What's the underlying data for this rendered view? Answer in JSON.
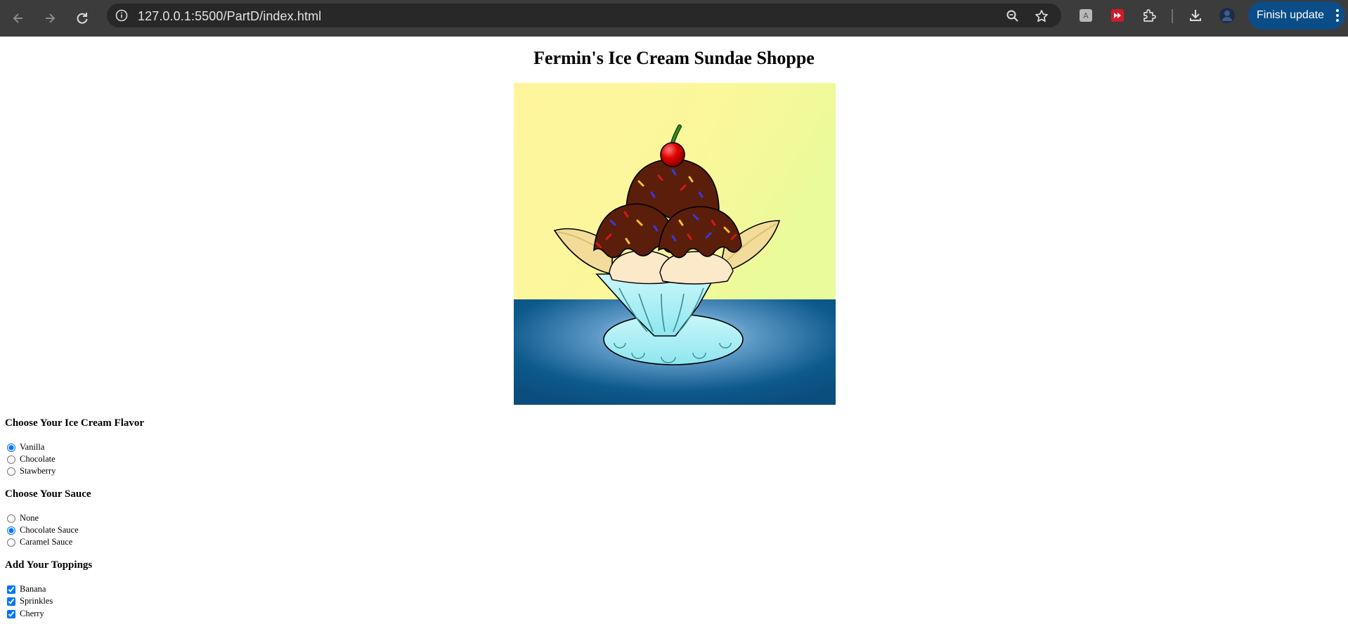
{
  "browser": {
    "url": "127.0.0.1:5500/PartD/index.html",
    "finish_update_label": "Finish update",
    "icons": [
      "back-icon",
      "forward-icon",
      "reload-icon",
      "site-info-icon",
      "zoom-icon",
      "bookmark-star-icon",
      "extension-icon",
      "extension-icon",
      "extensions-puzzle-icon",
      "download-icon",
      "profile-avatar",
      "more-menu-icon"
    ]
  },
  "page": {
    "title": "Fermin's Ice Cream Sundae Shoppe"
  },
  "flavor": {
    "heading": "Choose Your Ice Cream Flavor",
    "options": [
      {
        "label": "Vanilla",
        "checked": true
      },
      {
        "label": "Chocolate",
        "checked": false
      },
      {
        "label": "Stawberry",
        "checked": false
      }
    ]
  },
  "sauce": {
    "heading": "Choose Your Sauce",
    "options": [
      {
        "label": "None",
        "checked": false
      },
      {
        "label": "Chocolate Sauce",
        "checked": true
      },
      {
        "label": "Caramel Sauce",
        "checked": false
      }
    ]
  },
  "toppings": {
    "heading": "Add Your Toppings",
    "options": [
      {
        "label": "Banana",
        "checked": true
      },
      {
        "label": "Sprinkles",
        "checked": true
      },
      {
        "label": "Cherry",
        "checked": true
      }
    ]
  },
  "colors": {
    "chrome_bg": "#3c3c3c",
    "omnibox_bg": "#282828",
    "finish_btn_bg": "#0b4d86",
    "scene_sky": "#fff59d",
    "scene_table": "#0d5a8c",
    "bowl": "#aef0f4",
    "chocolate": "#5a1e0a"
  }
}
